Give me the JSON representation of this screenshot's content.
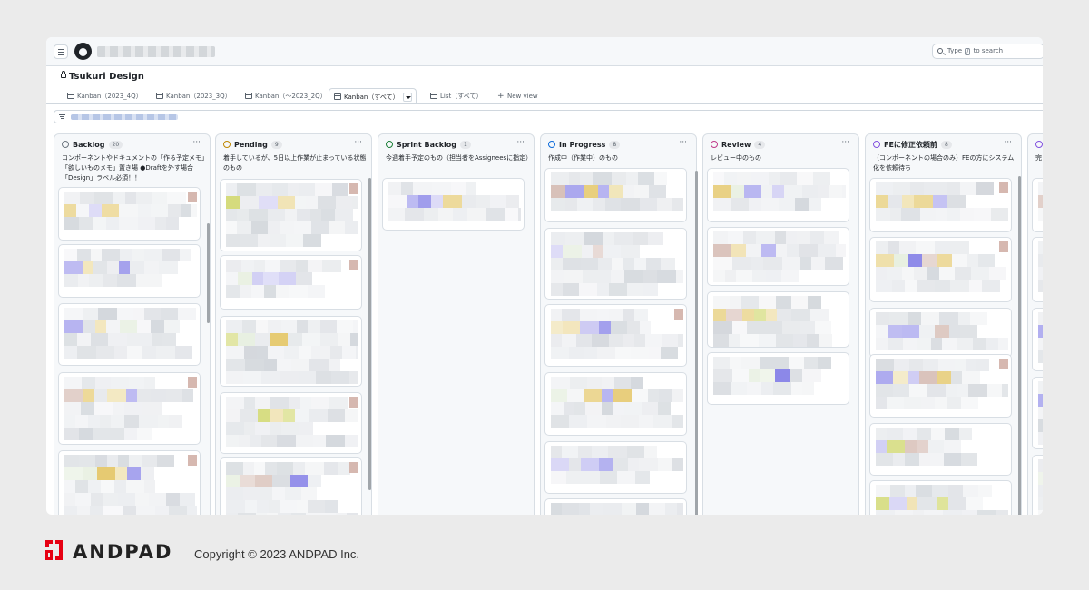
{
  "project": {
    "title": "Tsukuri Design"
  },
  "search": {
    "prefix": "Type",
    "key": "/",
    "suffix": "to search"
  },
  "tabs": [
    {
      "label": "Kanban（2023_4Q）"
    },
    {
      "label": "Kanban（2023_3Q）"
    },
    {
      "label": "Kanban（〜2023_2Q）"
    },
    {
      "label": "Kanban（すべて）"
    },
    {
      "label": "List（すべて）"
    }
  ],
  "new_view": "New view",
  "columns": [
    {
      "title": "Backlog",
      "count": "20",
      "color": "#6e7781",
      "desc": "コンポーネントやドキュメントの「作る予定メモ」「欲しいものメモ」置き場 ●Draftを外す場合「Design」ラベル必須！！"
    },
    {
      "title": "Pending",
      "count": "9",
      "color": "#bf8700",
      "desc": "着手しているが、5日以上作業が止まっている状態のもの"
    },
    {
      "title": "Sprint Backlog",
      "count": "1",
      "color": "#1a7f37",
      "desc": "今週着手予定のもの（担当者をAssigneesに指定）"
    },
    {
      "title": "In Progress",
      "count": "8",
      "color": "#0969da",
      "desc": "作成中（作業中）のもの"
    },
    {
      "title": "Review",
      "count": "4",
      "color": "#bf3989",
      "desc": "レビュー中のもの"
    },
    {
      "title": "FEに修正依頼前",
      "count": "8",
      "color": "#8250df",
      "desc": "（コンポーネントの場合のみ）FEの方にシステム化を依頼待ち"
    },
    {
      "title": "",
      "count": "",
      "color": "#8250df",
      "desc": "完"
    }
  ],
  "footer": {
    "brand": "ANDPAD",
    "copyright": "Copyright © 2023 ANDPAD Inc.",
    "brand_color": "#e60012"
  }
}
